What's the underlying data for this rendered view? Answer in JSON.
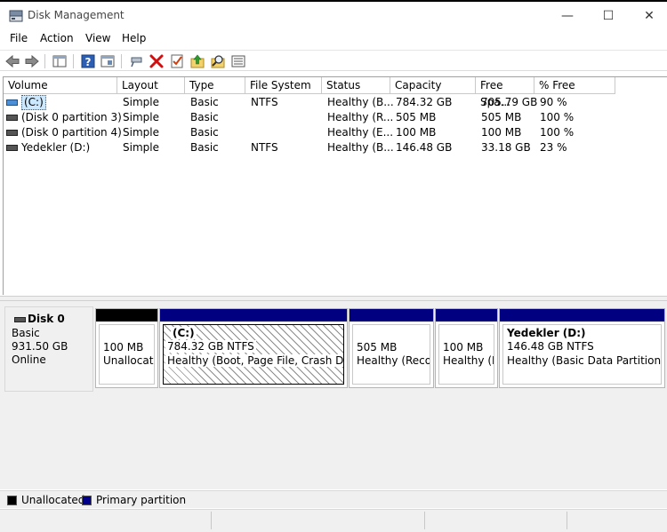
{
  "window": {
    "title": "Disk Management",
    "minimize_glyph": "—",
    "maximize_glyph": "☐",
    "close_glyph": "✕"
  },
  "menu": {
    "items": [
      "File",
      "Action",
      "View",
      "Help"
    ]
  },
  "toolbar": {
    "icons": [
      "back-arrow-icon",
      "forward-arrow-icon",
      "properties-pane-icon",
      "help-icon",
      "console-icon",
      "connect-drive-icon",
      "delete-icon",
      "checklist-icon",
      "folder-up-icon",
      "search-folder-icon",
      "list-view-icon"
    ]
  },
  "volume_table": {
    "headers": [
      "Volume",
      "Layout",
      "Type",
      "File System",
      "Status",
      "Capacity",
      "Free Spa...",
      "% Free"
    ],
    "rows": [
      {
        "volume": "(C:)",
        "layout": "Simple",
        "type": "Basic",
        "fs": "NTFS",
        "status": "Healthy (B...",
        "capacity": "784.32 GB",
        "free": "705.79 GB",
        "pct": "90 %",
        "selected": true
      },
      {
        "volume": "(Disk 0 partition 3)",
        "layout": "Simple",
        "type": "Basic",
        "fs": "",
        "status": "Healthy (R...",
        "capacity": "505 MB",
        "free": "505 MB",
        "pct": "100 %"
      },
      {
        "volume": "(Disk 0 partition 4)",
        "layout": "Simple",
        "type": "Basic",
        "fs": "",
        "status": "Healthy (E...",
        "capacity": "100 MB",
        "free": "100 MB",
        "pct": "100 %"
      },
      {
        "volume": "Yedekler (D:)",
        "layout": "Simple",
        "type": "Basic",
        "fs": "NTFS",
        "status": "Healthy (B...",
        "capacity": "146.48 GB",
        "free": "33.18 GB",
        "pct": "23 %"
      }
    ]
  },
  "disk": {
    "name": "Disk 0",
    "type": "Basic",
    "size": "931.50 GB",
    "state": "Online",
    "partitions": [
      {
        "title": "",
        "size": "100 MB",
        "status": "Unallocate",
        "kind": "unallocated"
      },
      {
        "title": "(C:)",
        "size": "784.32 GB NTFS",
        "status": "Healthy (Boot, Page File, Crash Dump",
        "kind": "primary",
        "selected": true
      },
      {
        "title": "",
        "size": "505 MB",
        "status": "Healthy (Recov",
        "kind": "primary"
      },
      {
        "title": "",
        "size": "100 MB",
        "status": "Healthy (El",
        "kind": "primary"
      },
      {
        "title": "Yedekler  (D:)",
        "size": "146.48 GB NTFS",
        "status": "Healthy (Basic Data Partition)",
        "kind": "primary"
      }
    ]
  },
  "legend": {
    "items": [
      {
        "label": "Unallocated",
        "color": "#000000"
      },
      {
        "label": "Primary partition",
        "color": "#00008b"
      }
    ]
  },
  "colors": {
    "unallocated": "#000000",
    "primary": "#000080",
    "selection": "#cce8ff"
  }
}
